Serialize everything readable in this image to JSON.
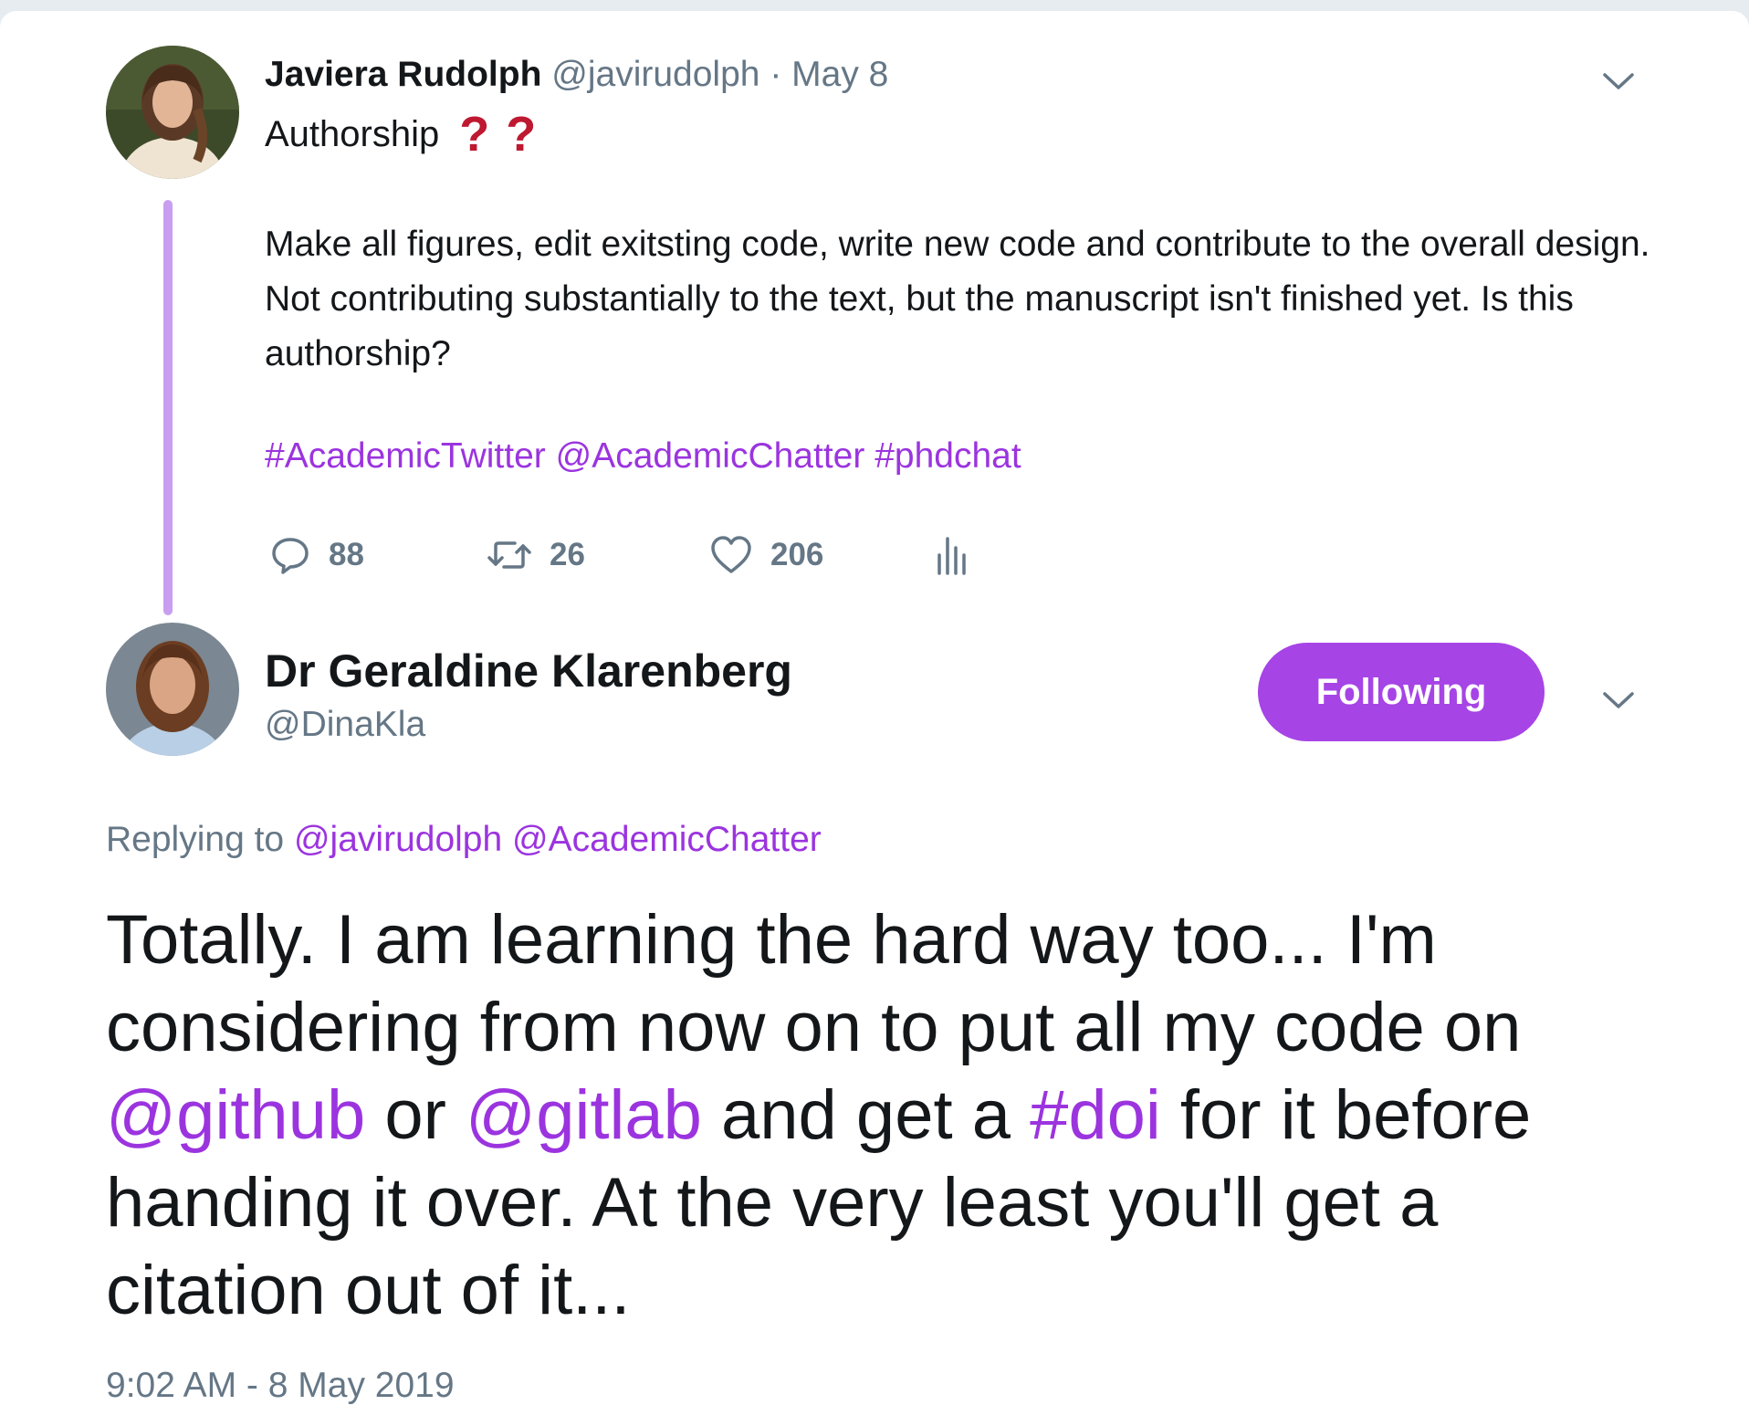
{
  "tweet1": {
    "name": "Javiera Rudolph",
    "handle": "@javirudolph",
    "separator": "·",
    "date": "May 8",
    "title": "Authorship",
    "title_emoji_1": "?",
    "title_emoji_2": "?",
    "body": "Make all figures, edit exitsting code, write new code and contribute to the overall design. Not contributing substantially to the text, but the manuscript isn't finished yet. Is this authorship?",
    "tags": [
      "#AcademicTwitter",
      "@AcademicChatter",
      "#phdchat"
    ],
    "reply_count": "88",
    "retweet_count": "26",
    "like_count": "206"
  },
  "tweet2": {
    "name": "Dr Geraldine Klarenberg",
    "handle": "@DinaKla",
    "follow_label": "Following",
    "replying_prefix": "Replying to",
    "replying_to": [
      "@javirudolph",
      "@AcademicChatter"
    ],
    "body_parts": [
      "Totally. I am learning the hard way too... I'm considering from now on to put all my code on ",
      "@github",
      " or ",
      "@gitlab",
      " and get a ",
      "#doi",
      " for it before handing it over. At the very least you'll get a citation out of it..."
    ],
    "timestamp": "9:02 AM - 8 May 2019"
  },
  "icons": {
    "reply": "reply-icon",
    "retweet": "retweet-icon",
    "like": "heart-icon",
    "analytics": "analytics-icon",
    "more": "chevron-down-icon"
  },
  "colors": {
    "accent": "#9b34df",
    "button": "#a644e6",
    "thread_line": "#c99ef0",
    "muted": "#657786",
    "emoji_red": "#be1931"
  }
}
